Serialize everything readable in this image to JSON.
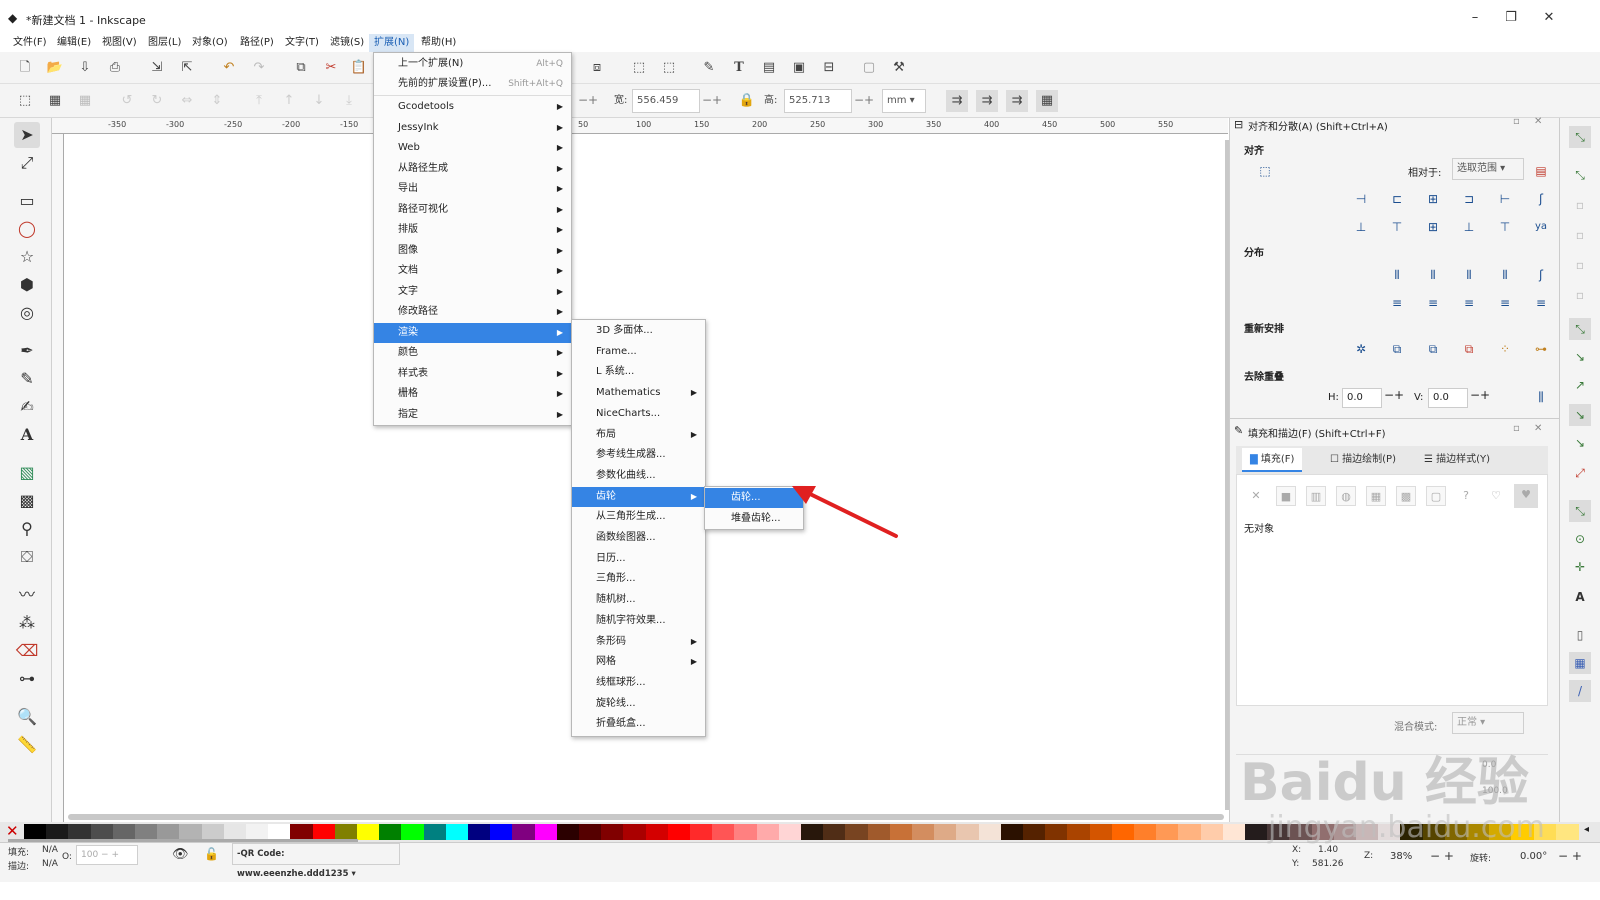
{
  "window": {
    "title": "*新建文档 1 - Inkscape",
    "minimize": "–",
    "restore": "❐",
    "close": "✕"
  },
  "menubar": [
    "文件(F)",
    "编辑(E)",
    "视图(V)",
    "图层(L)",
    "对象(O)",
    "路径(P)",
    "文字(T)",
    "滤镜(S)",
    "扩展(N)",
    "帮助(H)"
  ],
  "toolbar2": {
    "w_label": "宽:",
    "w_value": "556.459",
    "h_label": "高:",
    "h_value": "525.713",
    "unit": "mm"
  },
  "ruler_ticks": [
    "-350",
    "-300",
    "-250",
    "-200",
    "-150",
    "50",
    "100",
    "150",
    "200",
    "250",
    "300",
    "350",
    "400",
    "450",
    "500",
    "550"
  ],
  "extensions_menu": {
    "items": [
      {
        "label": "上一个扩展(N)",
        "accel": "Alt+Q"
      },
      {
        "label": "先前的扩展设置(P)...",
        "accel": "Shift+Alt+Q"
      },
      {
        "label": "Gcodetools"
      },
      {
        "label": "JessyInk"
      },
      {
        "label": "Web"
      },
      {
        "label": "从路径生成"
      },
      {
        "label": "导出"
      },
      {
        "label": "路径可视化"
      },
      {
        "label": "排版"
      },
      {
        "label": "图像"
      },
      {
        "label": "文档"
      },
      {
        "label": "文字"
      },
      {
        "label": "修改路径"
      },
      {
        "label": "渲染"
      },
      {
        "label": "颜色"
      },
      {
        "label": "样式表"
      },
      {
        "label": "栅格"
      },
      {
        "label": "指定"
      }
    ]
  },
  "render_menu": {
    "items": [
      {
        "label": "3D 多面体..."
      },
      {
        "label": "Frame..."
      },
      {
        "label": "L 系统..."
      },
      {
        "label": "Mathematics"
      },
      {
        "label": "NiceCharts..."
      },
      {
        "label": "布局"
      },
      {
        "label": "参考线生成器..."
      },
      {
        "label": "参数化曲线..."
      },
      {
        "label": "齿轮"
      },
      {
        "label": "从三角形生成..."
      },
      {
        "label": "函数绘图器..."
      },
      {
        "label": "日历..."
      },
      {
        "label": "三角形..."
      },
      {
        "label": "随机树..."
      },
      {
        "label": "随机字符效果..."
      },
      {
        "label": "条形码"
      },
      {
        "label": "网格"
      },
      {
        "label": "线框球形..."
      },
      {
        "label": "旋轮线..."
      },
      {
        "label": "折叠纸盒..."
      }
    ]
  },
  "gear_menu": {
    "items": [
      {
        "label": "齿轮..."
      },
      {
        "label": "堆叠齿轮..."
      }
    ]
  },
  "align_panel": {
    "title": "对齐和分散(A) (Shift+Ctrl+A)",
    "align_label": "对齐",
    "relative_label": "相对于:",
    "relative_value": "选取范围",
    "distribute_label": "分布",
    "rearrange_label": "重新安排",
    "remove_overlap_label": "去除重叠",
    "h_label": "H:",
    "h_value": "0.0",
    "v_label": "V:",
    "v_value": "0.0"
  },
  "fill_panel": {
    "title": "填充和描边(F) (Shift+Ctrl+F)",
    "tabs": [
      "填充(F)",
      "描边绘制(P)",
      "描边样式(Y)"
    ],
    "no_object": "无对象",
    "blend_label": "混合模式:",
    "blend_value": "正常",
    "blur_value": "0.0",
    "opacity_value": "100.0"
  },
  "statusbar": {
    "fill_label": "填充:",
    "fill_value": "N/A",
    "stroke_label": "描边:",
    "stroke_value": "N/A",
    "opacity_label": "O:",
    "opacity_value": "100",
    "layer": "-QR Code: www.eeenzhe.ddd1235",
    "x_label": "X:",
    "x_value": "1.40",
    "y_label": "Y:",
    "y_value": "581.26",
    "zoom_label": "Z:",
    "zoom_value": "38%",
    "rotate_label": "旋转:",
    "rotate_value": "0.00°"
  },
  "watermark": {
    "brand": "Baidu 经验",
    "url": "jingyan.baidu.com"
  },
  "colors": {
    "selection": "#3584e4",
    "arrow": "#e02020"
  },
  "palette": [
    "#000000",
    "#1a1a1a",
    "#333333",
    "#4d4d4d",
    "#666666",
    "#808080",
    "#999999",
    "#b3b3b3",
    "#cccccc",
    "#e6e6e6",
    "#f2f2f2",
    "#ffffff",
    "#800000",
    "#ff0000",
    "#808000",
    "#ffff00",
    "#008000",
    "#00ff00",
    "#008080",
    "#00ffff",
    "#000080",
    "#0000ff",
    "#800080",
    "#ff00ff",
    "#2b0000",
    "#550000",
    "#800000",
    "#aa0000",
    "#d40000",
    "#ff0000",
    "#ff2a2a",
    "#ff5555",
    "#ff8080",
    "#ffaaaa",
    "#ffd5d5",
    "#28170b",
    "#502d16",
    "#784421",
    "#a05a2c",
    "#c87137",
    "#d38d5f",
    "#deaa87",
    "#e9c6af",
    "#f4e3d7",
    "#2b1100",
    "#552200",
    "#803300",
    "#aa4400",
    "#d45500",
    "#ff6600",
    "#ff7f2a",
    "#ff9955",
    "#ffb380",
    "#ffccaa",
    "#ffe6d5",
    "#241c1c",
    "#483737",
    "#6c5353",
    "#916f6f",
    "#ac9393",
    "#c8b7b7",
    "#e3dbdb",
    "#2b2200",
    "#554400",
    "#806600",
    "#aa8800",
    "#d4aa00",
    "#ffcc00",
    "#ffdd55",
    "#ffe680"
  ]
}
